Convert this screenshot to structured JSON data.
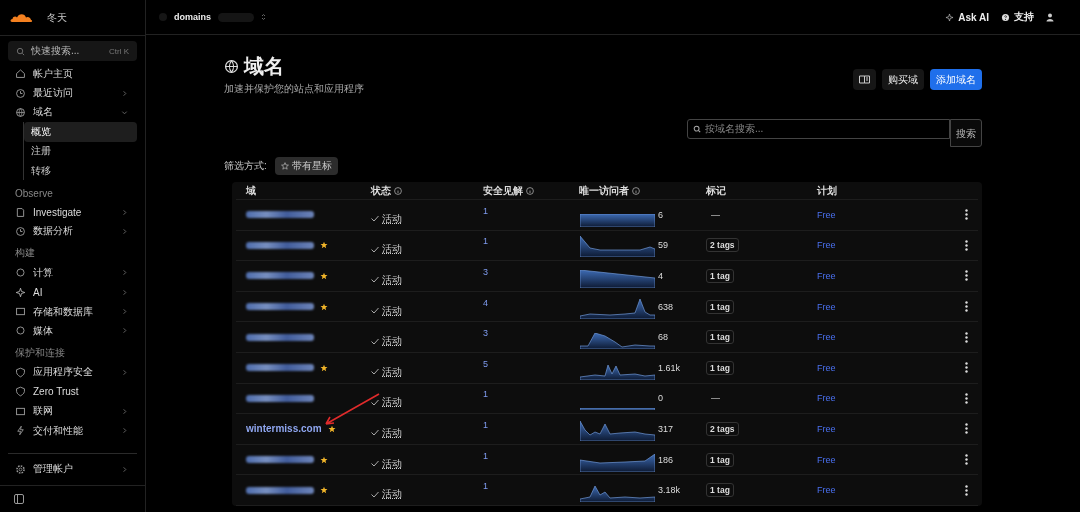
{
  "account": {
    "name": "冬天"
  },
  "sidebar": {
    "search": {
      "placeholder": "快速搜索...",
      "shortcut": "Ctrl K"
    },
    "sections": [
      {
        "items": [
          {
            "label": "帐户主页",
            "kind": "link"
          },
          {
            "label": "最近访问",
            "kind": "menu"
          },
          {
            "label": "域名",
            "kind": "group",
            "expanded": true,
            "children": [
              {
                "label": "概览",
                "selected": true
              },
              {
                "label": "注册",
                "selected": false
              },
              {
                "label": "转移",
                "selected": false
              }
            ]
          }
        ]
      },
      {
        "title": "Observe",
        "items": [
          {
            "label": "Investigate",
            "kind": "menu"
          },
          {
            "label": "数据分析",
            "kind": "menu"
          }
        ]
      },
      {
        "title": "构建",
        "items": [
          {
            "label": "计算",
            "kind": "menu"
          },
          {
            "label": "AI",
            "kind": "menu"
          },
          {
            "label": "存储和数据库",
            "kind": "menu"
          },
          {
            "label": "媒体",
            "kind": "menu"
          }
        ]
      },
      {
        "title": "保护和连接",
        "items": [
          {
            "label": "应用程序安全",
            "kind": "menu"
          },
          {
            "label": "Zero Trust",
            "kind": "link"
          },
          {
            "label": "联网",
            "kind": "menu"
          },
          {
            "label": "交付和性能",
            "kind": "menu"
          }
        ]
      }
    ],
    "footer": {
      "label": "管理帐户",
      "kind": "menu"
    }
  },
  "topbar": {
    "breadcrumb": "domains",
    "actions": [
      {
        "label": "Ask AI"
      },
      {
        "label": "支持"
      }
    ]
  },
  "page": {
    "title": "域名",
    "subtitle": "加速并保护您的站点和应用程序",
    "buttons": [
      {
        "kind": "icon"
      },
      {
        "kind": "secondary",
        "label": "购买域"
      },
      {
        "kind": "primary",
        "label": "添加域名"
      }
    ],
    "search": {
      "placeholder": "按域名搜索...",
      "button": "搜索"
    },
    "filter": {
      "label": "筛选方式:",
      "chip": "带有星标",
      "active": false
    }
  },
  "table": {
    "columns": [
      {
        "label": "域",
        "info": false
      },
      {
        "label": "状态",
        "info": true
      },
      {
        "label": "安全见解",
        "info": true
      },
      {
        "label": "唯一访问者",
        "info": true
      },
      {
        "label": "标记",
        "info": false
      },
      {
        "label": "计划",
        "info": false
      }
    ],
    "rows": [
      {
        "kind": "redacted",
        "starred": false,
        "arrow": false,
        "status": "活动",
        "insights": "1",
        "visitors": "6",
        "tags": "—",
        "plan": "Free"
      },
      {
        "kind": "redacted",
        "starred": true,
        "arrow": false,
        "status": "活动",
        "insights": "1",
        "visitors": "59",
        "tags": "2 tags",
        "plan": "Free"
      },
      {
        "kind": "redacted",
        "starred": true,
        "arrow": false,
        "status": "活动",
        "insights": "3",
        "visitors": "4",
        "tags": "1 tag",
        "plan": "Free"
      },
      {
        "kind": "redacted",
        "starred": true,
        "arrow": false,
        "status": "活动",
        "insights": "4",
        "visitors": "638",
        "tags": "1 tag",
        "plan": "Free"
      },
      {
        "kind": "redacted",
        "starred": false,
        "arrow": false,
        "status": "活动",
        "insights": "3",
        "visitors": "68",
        "tags": "1 tag",
        "plan": "Free"
      },
      {
        "kind": "redacted",
        "starred": true,
        "arrow": false,
        "status": "活动",
        "insights": "5",
        "visitors": "1.61k",
        "tags": "1 tag",
        "plan": "Free"
      },
      {
        "kind": "redacted",
        "starred": false,
        "arrow": false,
        "status": "活动",
        "insights": "1",
        "visitors": "0",
        "tags": "—",
        "plan": "Free"
      },
      {
        "kind": "named",
        "name": "wintermiss.com",
        "starred": true,
        "arrow": true,
        "status": "活动",
        "insights": "1",
        "visitors": "317",
        "tags": "2 tags",
        "plan": "Free"
      },
      {
        "kind": "redacted",
        "starred": true,
        "arrow": false,
        "status": "活动",
        "insights": "1",
        "visitors": "186",
        "tags": "1 tag",
        "plan": "Free"
      },
      {
        "kind": "redacted",
        "starred": true,
        "arrow": false,
        "status": "活动",
        "insights": "1",
        "visitors": "3.18k",
        "tags": "1 tag",
        "plan": "Free"
      }
    ]
  }
}
